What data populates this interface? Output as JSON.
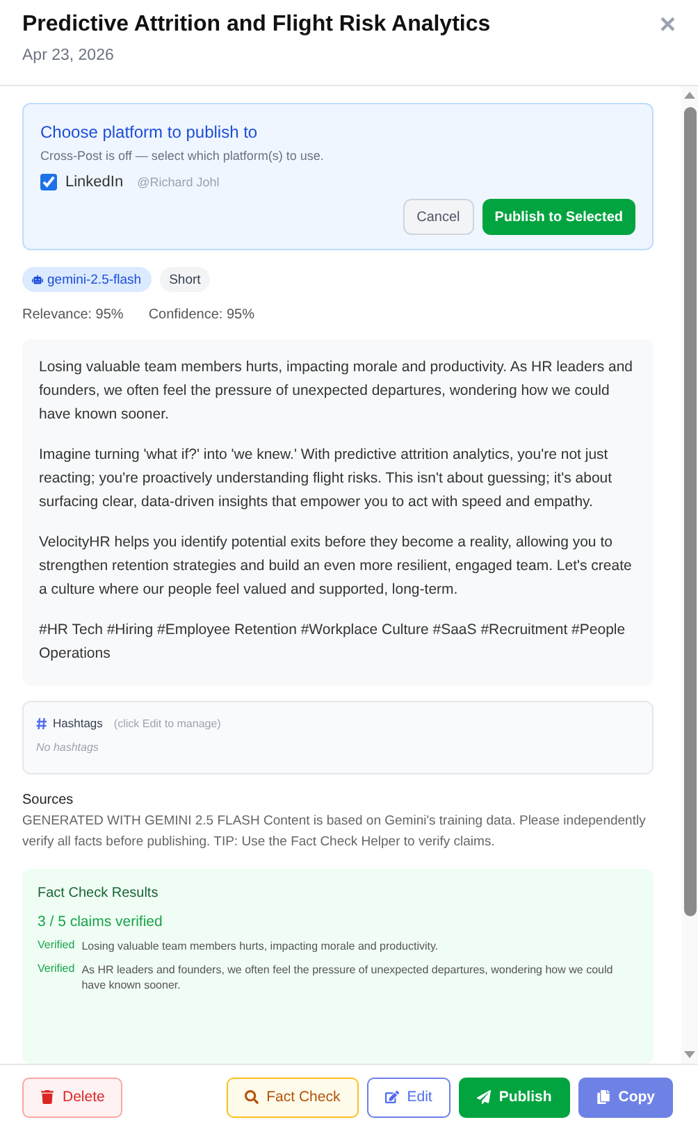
{
  "header": {
    "title": "Predictive Attrition and Flight Risk Analytics",
    "date": "Apr 23, 2026",
    "close": "×"
  },
  "publish_panel": {
    "title": "Choose platform to publish to",
    "note": "Cross-Post is off — select which platform(s) to use.",
    "platforms": [
      {
        "name": "LinkedIn",
        "handle": "@Richard Johl",
        "checked": true
      }
    ],
    "buttons": [
      {
        "label": "Cancel",
        "kind": "secondary"
      },
      {
        "label": "Publish to Selected",
        "kind": "primary"
      }
    ]
  },
  "tags": [
    {
      "label": "gemini-2.5-flash",
      "kind": "model"
    },
    {
      "label": "Short",
      "kind": "plain"
    }
  ],
  "scores": [
    "Relevance: 95%",
    "Confidence: 95%"
  ],
  "post": [
    "Losing valuable team members hurts, impacting morale and productivity. As HR leaders and founders, we often feel the pressure of unexpected departures, wondering how we could have known sooner.",
    "Imagine turning 'what if?' into 'we knew.' With predictive attrition analytics, you're not just reacting; you're proactively understanding flight risks. This isn't about guessing; it's about surfacing clear, data-driven insights that empower you to act with speed and empathy.",
    "VelocityHR helps you identify potential exits before they become a reality, allowing you to strengthen retention strategies and build an even more resilient, engaged team. Let's create a culture where our people feel valued and supported, long-term.",
    "#HR Tech #Hiring #Employee Retention #Workplace Culture #SaaS #Recruitment #People Operations"
  ],
  "hashtags": {
    "title": "Hashtags",
    "hint": "(click Edit to manage)",
    "empty": "No hashtags"
  },
  "sources": {
    "title": "Sources",
    "text": "GENERATED WITH GEMINI 2.5 FLASH Content is based on Gemini's training data. Please independently verify all facts before publishing. TIP: Use the Fact Check Helper to verify claims."
  },
  "fact_check": {
    "title": "Fact Check Results",
    "summary": "3 / 5 claims verified",
    "claims": [
      {
        "status": "Verified",
        "kind": "verified",
        "text": "Losing valuable team members hurts, impacting morale and productivity."
      },
      {
        "status": "Verified",
        "kind": "verified",
        "text": "As HR leaders and founders, we often feel the pressure of unexpected departures, wondering how we could have known sooner."
      }
    ]
  },
  "footer": [
    {
      "label": "Delete",
      "kind": "delete"
    },
    {
      "label": "Fact Check",
      "kind": "factcheck"
    },
    {
      "label": "Edit",
      "kind": "edit"
    },
    {
      "label": "Publish",
      "kind": "publish"
    },
    {
      "label": "Copy",
      "kind": "copy"
    }
  ]
}
